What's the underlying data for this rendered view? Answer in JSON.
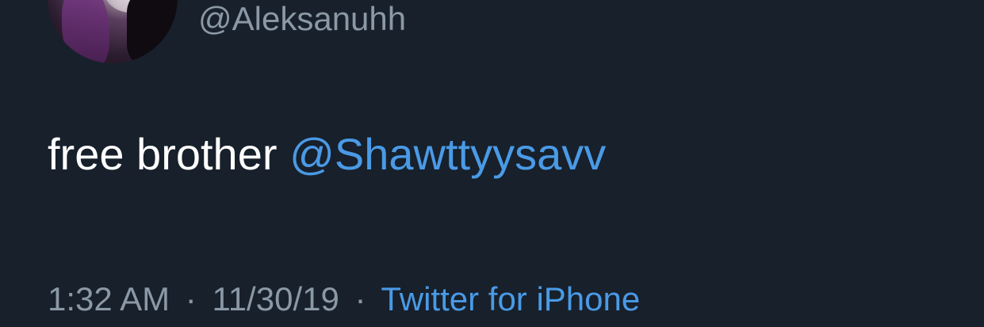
{
  "user": {
    "handle": "@Aleksanuhh"
  },
  "tweet": {
    "text": "free brother",
    "mention": "@Shawttyysavv"
  },
  "meta": {
    "time": "1:32 AM",
    "separator": "·",
    "date": "11/30/19",
    "source": "Twitter for iPhone"
  },
  "colors": {
    "background": "#17202b",
    "text": "#ffffff",
    "secondary": "#8b98a5",
    "link": "#4a9ae6"
  }
}
